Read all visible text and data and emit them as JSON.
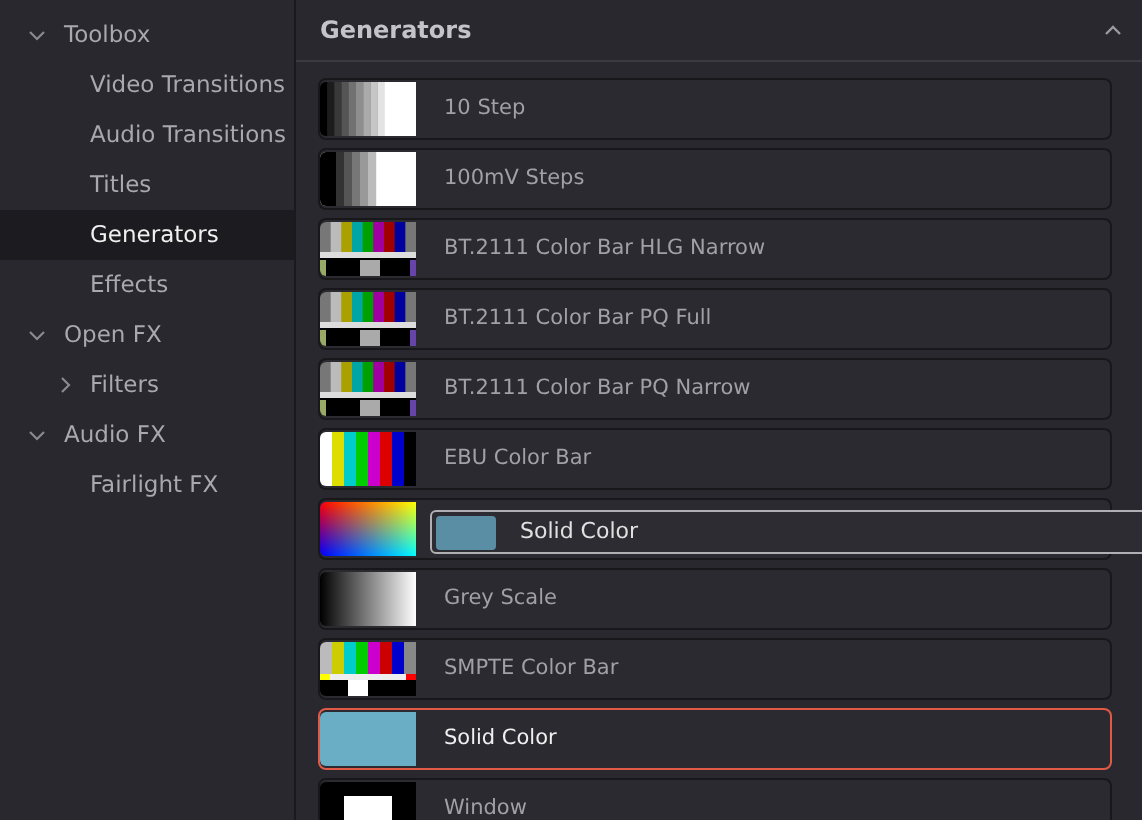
{
  "sidebar": {
    "items": [
      {
        "label": "Toolbox",
        "expanded": true,
        "selected": false,
        "children": [
          {
            "label": "Video Transitions",
            "selected": false
          },
          {
            "label": "Audio Transitions",
            "selected": false
          },
          {
            "label": "Titles",
            "selected": false
          },
          {
            "label": "Generators",
            "selected": true
          },
          {
            "label": "Effects",
            "selected": false
          }
        ]
      },
      {
        "label": "Open FX",
        "expanded": true,
        "selected": false,
        "children": [
          {
            "label": "Filters",
            "expanded": false,
            "selected": false
          }
        ]
      },
      {
        "label": "Audio FX",
        "expanded": true,
        "selected": false,
        "children": [
          {
            "label": "Fairlight FX",
            "selected": false
          }
        ]
      }
    ]
  },
  "panel": {
    "title": "Generators",
    "collapsed": false,
    "items": [
      {
        "kind": "steps10",
        "label": "10 Step",
        "selected": false
      },
      {
        "kind": "steps100mv",
        "label": "100mV Steps",
        "selected": false
      },
      {
        "kind": "bt2111",
        "label": "BT.2111 Color Bar HLG Narrow",
        "selected": false
      },
      {
        "kind": "bt2111",
        "label": "BT.2111 Color Bar PQ Full",
        "selected": false
      },
      {
        "kind": "bt2111",
        "label": "BT.2111 Color Bar PQ Narrow",
        "selected": false
      },
      {
        "kind": "ebu",
        "label": "EBU Color Bar",
        "selected": false
      },
      {
        "kind": "gradient",
        "selected": false
      },
      {
        "kind": "greyscale",
        "label": "Grey Scale",
        "selected": false
      },
      {
        "kind": "smpte",
        "label": "SMPTE Color Bar",
        "selected": false
      },
      {
        "kind": "solid",
        "label": "Solid Color",
        "selected": true
      },
      {
        "kind": "window",
        "label": "Window",
        "selected": false
      }
    ],
    "drag_ghost": {
      "label": "Solid Color"
    }
  }
}
